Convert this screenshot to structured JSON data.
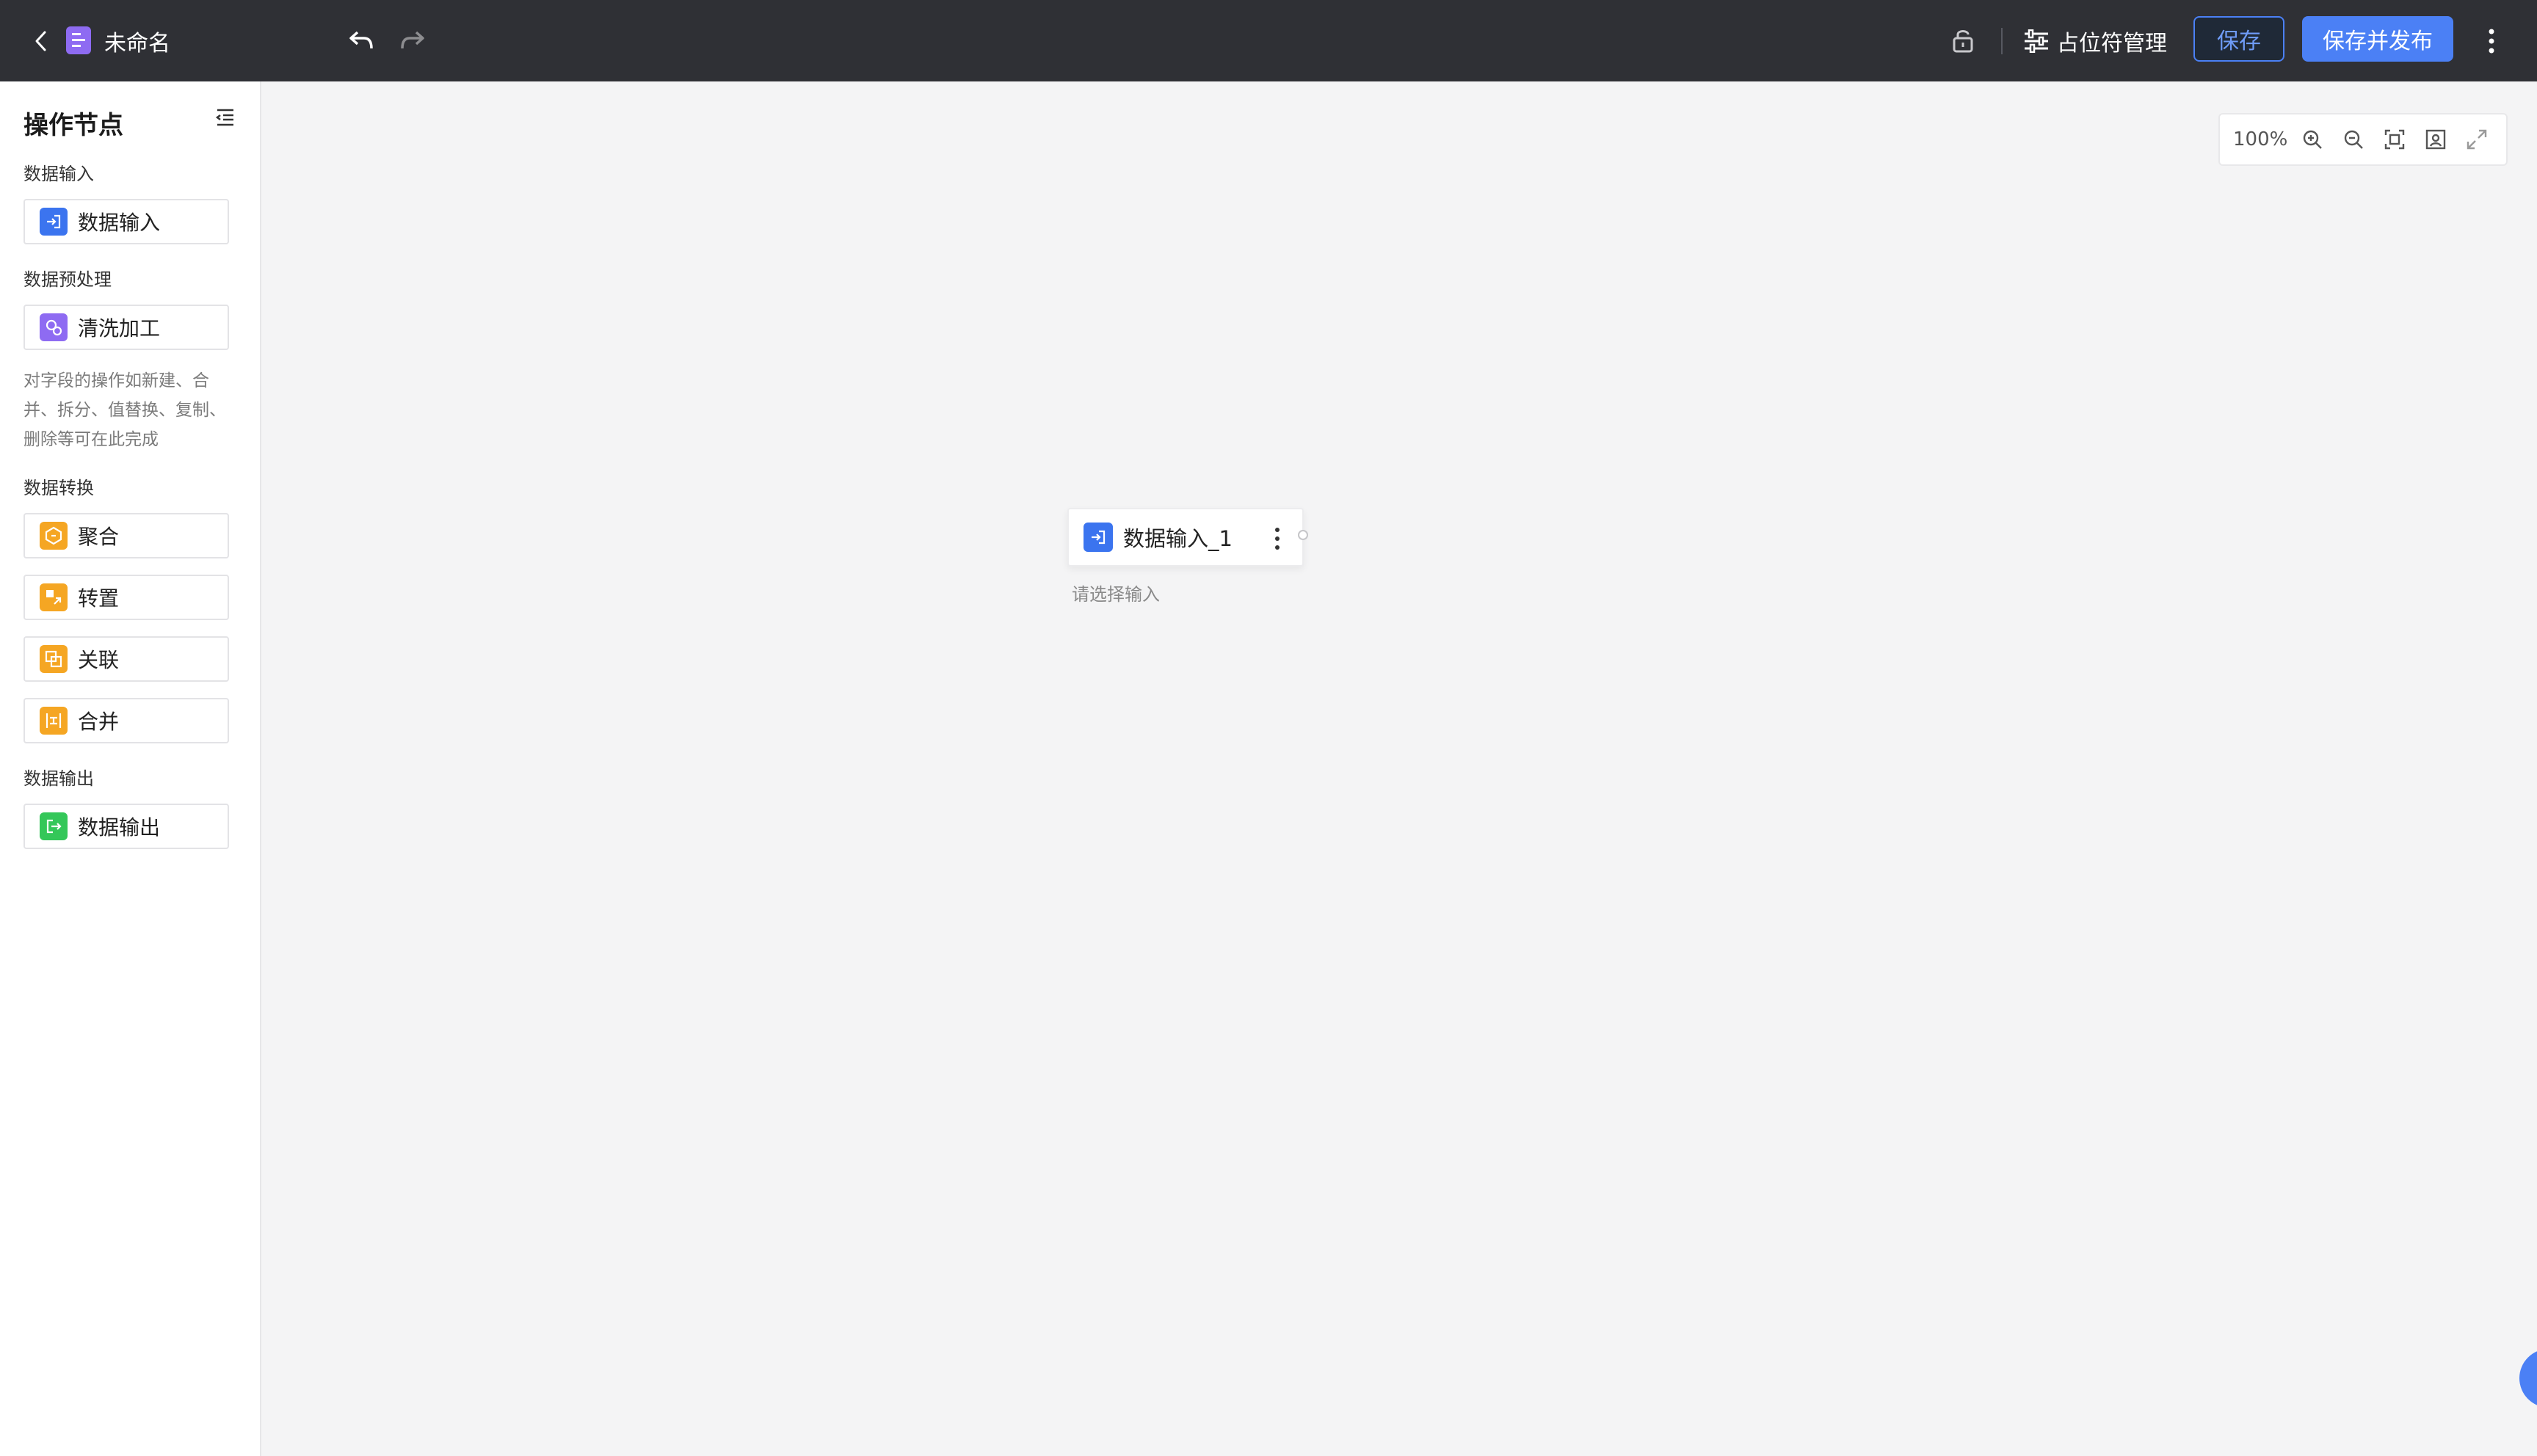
{
  "header": {
    "doc_title": "未命名",
    "placeholder_manage": "占位符管理",
    "save": "保存",
    "save_publish": "保存并发布"
  },
  "sidebar": {
    "title": "操作节点",
    "sections": {
      "input": "数据输入",
      "preprocess": "数据预处理",
      "transform": "数据转换",
      "output": "数据输出"
    },
    "nodes": {
      "data_input": "数据输入",
      "clean": "清洗加工",
      "aggregate": "聚合",
      "transpose": "转置",
      "join": "关联",
      "merge": "合并",
      "data_output": "数据输出"
    },
    "clean_desc": "对字段的操作如新建、合并、拆分、值替换、复制、删除等可在此完成"
  },
  "canvas": {
    "zoom": "100%",
    "node_label": "数据输入_1",
    "node_hint": "请选择输入"
  },
  "colors": {
    "topbar": "#2f3035",
    "accent": "#4b80f5",
    "input_icon": "#3b74ef",
    "clean_icon": "#8e6bf2",
    "transform_icon": "#f5a623",
    "output_icon": "#34c759"
  }
}
